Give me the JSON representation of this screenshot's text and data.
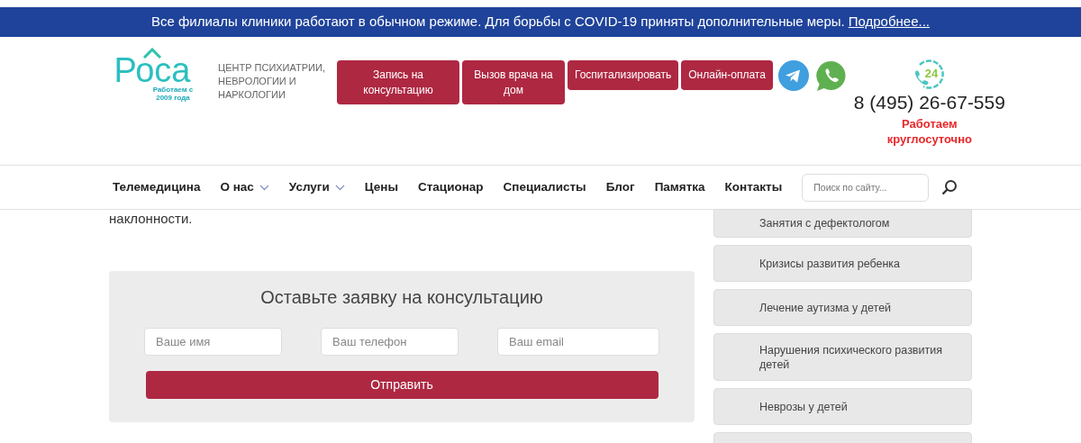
{
  "banner": {
    "text": "Все филиалы клиники работают в обычном режиме. Для борьбы с COVID-19 приняты дополнительные меры.",
    "link": "Подробнее..."
  },
  "logo": {
    "name": "Роса",
    "tagline": "Работаем с 2009 года",
    "subtitle": "ЦЕНТР ПСИХИАТРИИ, НЕВРОЛОГИИ И НАРКОЛОГИИ"
  },
  "action_buttons": [
    {
      "label": "Запись на консультацию"
    },
    {
      "label": "Вызов врача на дом"
    },
    {
      "label": "Госпитализировать"
    },
    {
      "label": "Онлайн-оплата"
    }
  ],
  "contact": {
    "badge": "24",
    "phone": "8 (495) 26-67-559",
    "hours": "Работаем круглосуточно"
  },
  "nav": [
    {
      "label": "Телемедицина",
      "has_menu": false
    },
    {
      "label": "О нас",
      "has_menu": true
    },
    {
      "label": "Услуги",
      "has_menu": true
    },
    {
      "label": "Цены",
      "has_menu": false
    },
    {
      "label": "Стационар",
      "has_menu": false
    },
    {
      "label": "Специалисты",
      "has_menu": false
    },
    {
      "label": "Блог",
      "has_menu": false
    },
    {
      "label": "Памятка",
      "has_menu": false
    },
    {
      "label": "Контакты",
      "has_menu": false
    }
  ],
  "search": {
    "placeholder": "Поиск по сайту..."
  },
  "article": {
    "text": "наклонности."
  },
  "form": {
    "title": "Оставьте заявку на консультацию",
    "fields": [
      {
        "placeholder": "Ваше имя"
      },
      {
        "placeholder": "Ваш телефон"
      },
      {
        "placeholder": "Ваш email"
      }
    ],
    "submit": "Отправить"
  },
  "sidebar": {
    "items": [
      {
        "label": "Занятия с дефектологом"
      },
      {
        "label": "Кризисы развития ребенка"
      },
      {
        "label": "Лечение аутизма у детей"
      },
      {
        "label": "Нарушения психического развития детей"
      },
      {
        "label": "Неврозы у детей"
      }
    ]
  }
}
